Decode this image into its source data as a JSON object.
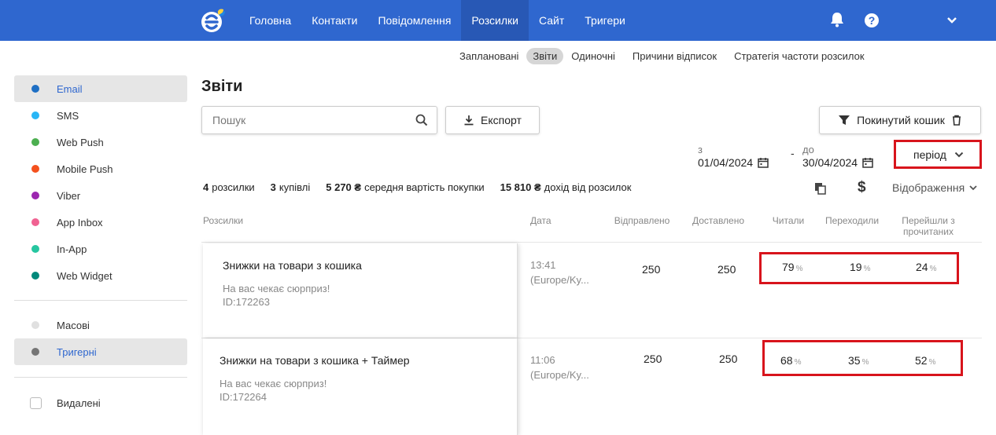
{
  "topnav": {
    "items": [
      "Головна",
      "Контакти",
      "Повідомлення",
      "Розсилки",
      "Сайт",
      "Тригери"
    ],
    "active_index": 3
  },
  "subnav": {
    "items": [
      "Заплановані",
      "Звіти",
      "Одиночні",
      "Причини відписок",
      "Стратегія частоти розсилок"
    ],
    "active_index": 1
  },
  "sidebar": {
    "channels": [
      {
        "label": "Email",
        "color": "#1e6fc4",
        "active": true
      },
      {
        "label": "SMS",
        "color": "#29b6f6"
      },
      {
        "label": "Web Push",
        "color": "#4caf50"
      },
      {
        "label": "Mobile Push",
        "color": "#f4511e"
      },
      {
        "label": "Viber",
        "color": "#9c27b0"
      },
      {
        "label": "App Inbox",
        "color": "#f06292"
      },
      {
        "label": "In-App",
        "color": "#26c6a0"
      },
      {
        "label": "Web Widget",
        "color": "#00897b"
      }
    ],
    "types": [
      {
        "label": "Масові",
        "color": "#e0e0e0"
      },
      {
        "label": "Тригерні",
        "color": "#757575",
        "active": true
      }
    ],
    "deleted_label": "Видалені"
  },
  "page": {
    "title": "Звіти",
    "search_placeholder": "Пошук",
    "export_label": "Експорт",
    "abandoned_cart_label": "Покинутий кошик",
    "date_from_label": "з",
    "date_from": "01/04/2024",
    "date_sep": "-",
    "date_to_label": "до",
    "date_to": "30/04/2024",
    "period_label": "період",
    "display_label": "Відображення"
  },
  "stats": [
    {
      "value": "4",
      "label": "розсилки"
    },
    {
      "value": "3",
      "label": "купівлі"
    },
    {
      "value": "5 270 ₴",
      "label": "середня вартість покупки"
    },
    {
      "value": "15 810 ₴",
      "label": "дохід від розсилок"
    }
  ],
  "table": {
    "headers": {
      "name": "Розсилки",
      "date": "Дата",
      "sent": "Відправлено",
      "delivered": "Доставлено",
      "read": "Читали",
      "clicked": "Переходили",
      "clicked_from_read": "Перейшли з прочитаних"
    },
    "rows": [
      {
        "title": "Знижки на товари з кошика",
        "subject": "На вас чекає сюрприз!",
        "id": "ID:172263",
        "time": "13:41",
        "tz": "(Europe/Ky...",
        "sent": "250",
        "delivered": "250",
        "read": "79",
        "clicked": "19",
        "clicked_from_read": "24"
      },
      {
        "title": "Знижки на товари з кошика + Таймер",
        "subject": "На вас чекає сюрприз!",
        "id": "ID:172264",
        "time": "11:06",
        "tz": "(Europe/Ky...",
        "sent": "250",
        "delivered": "250",
        "read": "68",
        "clicked": "35",
        "clicked_from_read": "52"
      }
    ],
    "pct_sign": "%"
  }
}
